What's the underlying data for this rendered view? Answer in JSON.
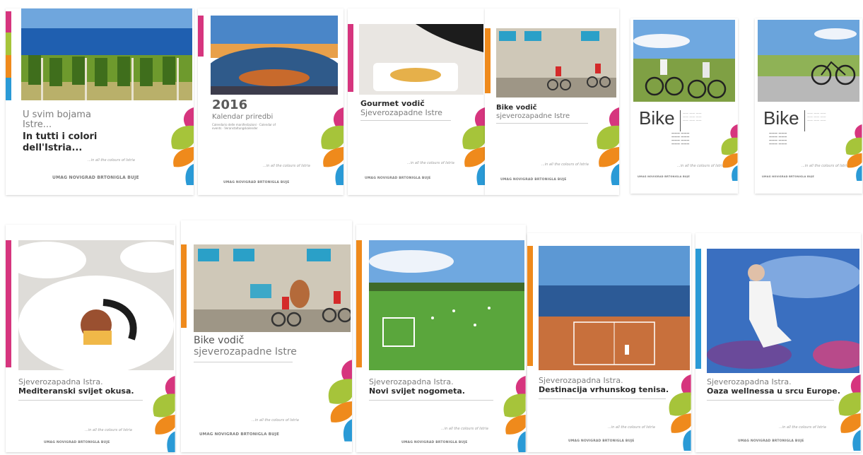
{
  "covers": [
    {
      "line1": "U svim bojama",
      "line2": "Istre...",
      "line3": "In tutti i colori",
      "line4": "dell'Istria...",
      "tagline": "...in all the colours of Istria",
      "towns": "UMAG   NOVIGRAD   BRTONIGLA   BUJE"
    },
    {
      "year": "2016",
      "title": "Kalendar priredbi",
      "sub": "Calendario delle manifestazioni · Calendar of events · Veranstaltungskalender",
      "tagline": "...in all the colours of Istria",
      "towns": "UMAG  NOVIGRAD  BRTONIGLA  BUJE"
    },
    {
      "line1": "Gourmet vodič",
      "line2": "Sjeverozapadne Istre",
      "tagline": "...in all the colours of Istria",
      "towns": "UMAG  NOVIGRAD  BRTONIGLA  BUJE"
    },
    {
      "line1": "Bike vodič",
      "line2": "sjeverozapadne Istre",
      "tagline": "...in all the colours of Istria",
      "towns": "UMAG  NOVIGRAD  BRTONIGLA  BUJE"
    },
    {
      "word": "Bike",
      "tagline": "...in all the colours of Istria",
      "towns": "UMAG  NOVIGRAD  BRTONIGLA  BUJE"
    },
    {
      "word": "Bike",
      "tagline": "...in all the colours of Istria",
      "towns": "UMAG  NOVIGRAD  BRTONIGLA  BUJE"
    },
    {
      "line1": "Sjeverozapadna Istra.",
      "line2": "Mediteranski svijet okusa.",
      "tagline": "...in all the colours of Istria",
      "towns": "UMAG  NOVIGRAD  BRTONIGLA  BUJE"
    },
    {
      "line1": "Bike vodič",
      "line2": "sjeverozapadne Istre",
      "tagline": "...in all the colours of Istria",
      "towns": "UMAG  NOVIGRAD  BRTONIGLA  BUJE"
    },
    {
      "line1": "Sjeverozapadna Istra.",
      "line2": "Novi svijet nogometa.",
      "tagline": "...in all the colours of Istria",
      "towns": "UMAG  NOVIGRAD  BRTONIGLA  BUJE"
    },
    {
      "line1": "Sjeverozapadna Istra.",
      "line2": "Destinacija vrhunskog tenisa.",
      "tagline": "...in all the colours of Istria",
      "towns": "UMAG  NOVIGRAD  BRTONIGLA  BUJE"
    },
    {
      "line1": "Sjeverozapadna Istra.",
      "line2": "Oaza wellnessa u srcu Europe.",
      "tagline": "...in all the colours of Istria",
      "towns": "UMAG  NOVIGRAD  BRTONIGLA  BUJE"
    }
  ],
  "colors": {
    "magenta": "#d6357e",
    "lime": "#a6c43a",
    "orange": "#ef8a1c",
    "blue": "#2a9ad6",
    "green": "#7cb342"
  }
}
